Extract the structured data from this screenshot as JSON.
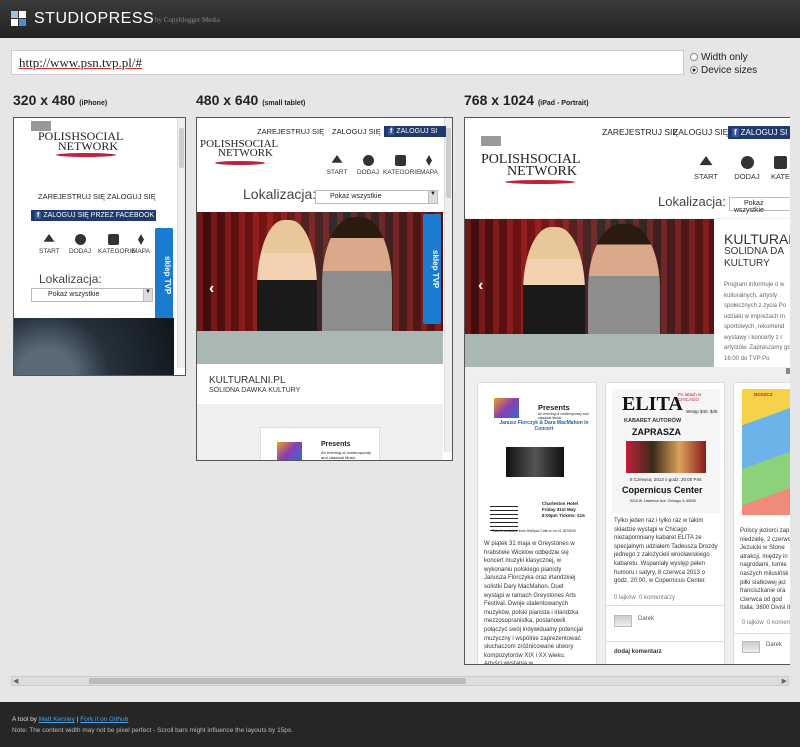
{
  "header": {
    "brand": "STUDIOPRESS",
    "byline": "by Copyblogger Media"
  },
  "url": {
    "value": "http://www.psn.tvp.pl/#"
  },
  "options": {
    "width_only": "Width only",
    "device_sizes": "Device sizes",
    "selected": "Device sizes"
  },
  "devices": [
    {
      "size": "320 x 480",
      "label": "(iPhone)"
    },
    {
      "size": "480 x 640",
      "label": "(small tablet)"
    },
    {
      "size": "768 x 1024",
      "label": "(iPad - Portrait)"
    }
  ],
  "site": {
    "logo_line1": "POLISHSOCIAL",
    "logo_line2": "NETWORK",
    "register": "ZAREJESTRUJ SIĘ",
    "login": "ZALOGUJ SIĘ",
    "facebook_full": "ZALOGUJ SIĘ PRZEZ FACEBOOK",
    "facebook_short": "ZALOGUJ SI",
    "nav": [
      "START",
      "DODAJ",
      "KATEGORIE",
      "MAPA"
    ],
    "nav_short": "KATE",
    "location_label": "Lokalizacja:",
    "location_value": "Pokaż wszystkie",
    "sklep": "sklep",
    "tvp": "TVP",
    "slide_title": "KULTURALNI.PL",
    "slide_subtitle": "SOLIDNA DAWKA KULTURY",
    "slide_title_ipad": "KULTURAL",
    "slide_subtitle_ipad": "SOLIDNA DA",
    "slide_sub2_ipad": "KULTURY",
    "slide_para_ipad": "Program informuje o w kulturalnych, artysty społecznych z życia Po udziału w imprezach m sportowych, rekomend wystawy i koncerty z r artystów. Zapraszamy godz. 16:00 do TVP Po",
    "presents": "Presents",
    "presents_sub": "An evening of contemporary and classical Music",
    "presents_names": "Janusz Florczyk & Dara MacMahon in Concert",
    "concert_place": "Charleston Hotel Friday 31st May 8:00pm Tickets: €15",
    "concert_tix": "Tickets available from HotSpot Café or on 01 2876020",
    "elita": "ELITA",
    "elita_sub": "KABARET AUTORÓW",
    "elita_top": "Po latach w CHICAGO",
    "elita_tix": "Wstęp $40, $45",
    "zaprasza": "ZAPRASZA",
    "elita_date": "8 Czerwca, 2013 o godz. 20:00 P.M.",
    "copernicus": "Copernicus Center",
    "copernicus_addr": "5216 W. Lawrence Ave. Chicago, IL 60630",
    "card1_text": "W piątek 31 maja w Greystones w hrabstwie Wicklow odbędzie się koncert muzyki klasycznej, w wykonaniu polskiego pianisty Janusza Florczyka oraz irlandzkiej solistki Dary MacMahon. Duet wystąpi w ramach Greystones Arts Festival. Dwoje utalentowanych muzyków, polski pianista i irlandzka mezzosopranistka, postanowili połączyć swój indywidualny potencjał muzyczny i wspólnie zaprezentować słuchaczom zróżnicowane utwory kompozytorów XIX i XX wieku. Artyści wystąpią w",
    "card2_text": "Tylko jeden raz i tylko raz w takim składzie wystąpi w Chicago niezapomniany kabaret ELITA ze specjalnym udziałem Tadeusza Drozdy jednego z założycieli wrocławskiego kabaretu. Wspaniały występ pełen humoru i satyry, 8 czerwca 2013 o godz. 20:00, w Copernicus Center.",
    "card3_text": "Polscy jeziorci zap niedzielę, 2 czerwc Jezuicki w Stone atrakcji, między in nagrodami, turnie naszych milusińsk piłki siatkowej jez franciszkanie ora czerwca od god Italia, 3800 Divisi IL 60615.",
    "likes": "0 lajków",
    "comments": "0 komentarzy",
    "author": "Darek",
    "add_comment": "dodaj komentarz",
    "festival": "GREYSTONES ARTS FESTIVAL",
    "wszcz": "NOSZCZ"
  },
  "footer": {
    "prefix": "A tool by",
    "author": "Matt Kersley",
    "sep": "|",
    "github": "Fork it on Github",
    "note": "Note: The content width may not be pixel perfect - Scroll bars might influence the layouts by 15px."
  },
  "colors": {
    "topbar": "#262626",
    "facebook": "#1e3a6e",
    "sklep": "#1a7bd1",
    "accent": "#c0213a",
    "link": "#4ea0ea"
  }
}
